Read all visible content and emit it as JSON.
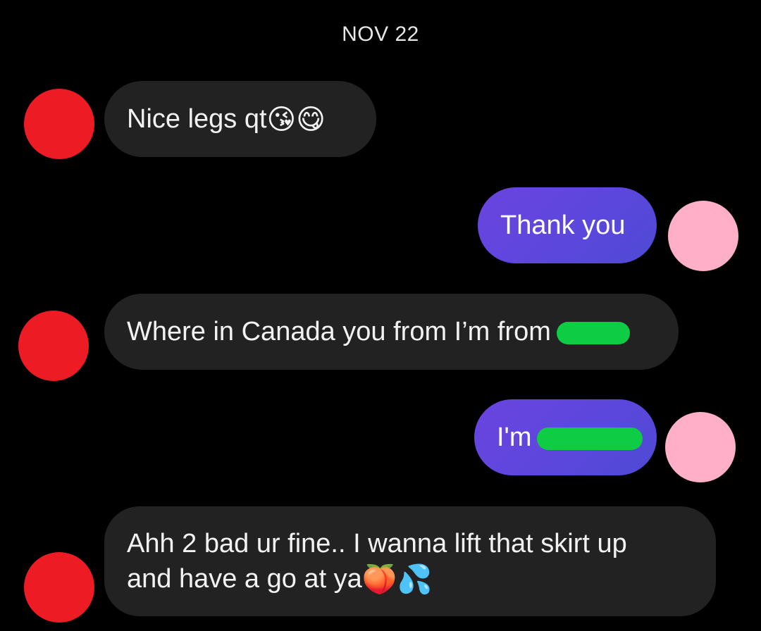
{
  "date_divider": "NOV 22",
  "colors": {
    "background": "#000000",
    "incoming_bubble": "#222222",
    "outgoing_bubble": "#5b47dc",
    "them_avatar": "#ed1c24",
    "me_avatar": "#ffb0c8",
    "redaction": "#0fcc45"
  },
  "messages": [
    {
      "sender": "them",
      "text": "Nice legs qt",
      "emojis": [
        "😘",
        "😋"
      ]
    },
    {
      "sender": "me",
      "text": "Thank you"
    },
    {
      "sender": "them",
      "text": "Where in Canada you from I’m from",
      "redacted": true
    },
    {
      "sender": "me",
      "text": "I'm",
      "redacted": true
    },
    {
      "sender": "them",
      "lines": [
        "Ahh 2 bad ur fine.. I wanna lift that skirt up",
        "and have a go at ya"
      ],
      "emojis": [
        "🍑",
        "💦"
      ]
    }
  ]
}
